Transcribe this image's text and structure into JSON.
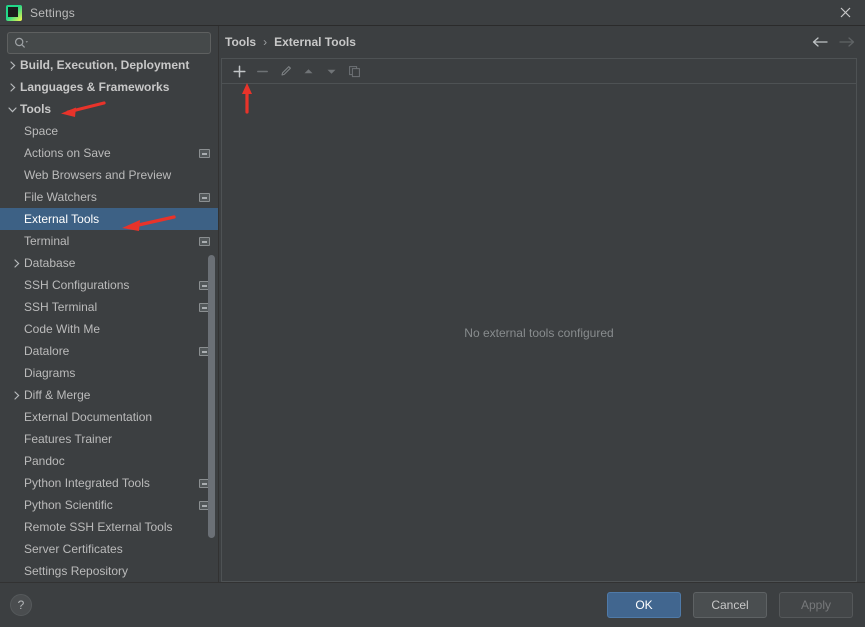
{
  "window": {
    "title": "Settings",
    "app_icon": "pycharm-logo-icon",
    "close_label": "×"
  },
  "search": {
    "value": "",
    "placeholder": "",
    "icon": "search-icon"
  },
  "sidebar": {
    "items": [
      {
        "label": "Build, Execution, Deployment",
        "level": 0,
        "group": true,
        "chevron": "›",
        "badge": false,
        "selected": false,
        "clipped": true
      },
      {
        "label": "Languages & Frameworks",
        "level": 0,
        "group": true,
        "chevron": "›",
        "badge": false,
        "selected": false
      },
      {
        "label": "Tools",
        "level": 0,
        "group": true,
        "chevron": "∨",
        "badge": false,
        "selected": false
      },
      {
        "label": "Space",
        "level": 1,
        "group": false,
        "chevron": "",
        "badge": false,
        "selected": false
      },
      {
        "label": "Actions on Save",
        "level": 1,
        "group": false,
        "chevron": "",
        "badge": true,
        "selected": false
      },
      {
        "label": "Web Browsers and Preview",
        "level": 1,
        "group": false,
        "chevron": "",
        "badge": false,
        "selected": false
      },
      {
        "label": "File Watchers",
        "level": 1,
        "group": false,
        "chevron": "",
        "badge": true,
        "selected": false
      },
      {
        "label": "External Tools",
        "level": 1,
        "group": false,
        "chevron": "",
        "badge": false,
        "selected": true
      },
      {
        "label": "Terminal",
        "level": 1,
        "group": false,
        "chevron": "",
        "badge": true,
        "selected": false
      },
      {
        "label": "Database",
        "level": 1,
        "group": false,
        "chevron": "›",
        "badge": false,
        "selected": false
      },
      {
        "label": "SSH Configurations",
        "level": 1,
        "group": false,
        "chevron": "",
        "badge": true,
        "selected": false
      },
      {
        "label": "SSH Terminal",
        "level": 1,
        "group": false,
        "chevron": "",
        "badge": true,
        "selected": false
      },
      {
        "label": "Code With Me",
        "level": 1,
        "group": false,
        "chevron": "",
        "badge": false,
        "selected": false
      },
      {
        "label": "Datalore",
        "level": 1,
        "group": false,
        "chevron": "",
        "badge": true,
        "selected": false
      },
      {
        "label": "Diagrams",
        "level": 1,
        "group": false,
        "chevron": "",
        "badge": false,
        "selected": false
      },
      {
        "label": "Diff & Merge",
        "level": 1,
        "group": false,
        "chevron": "›",
        "badge": false,
        "selected": false
      },
      {
        "label": "External Documentation",
        "level": 1,
        "group": false,
        "chevron": "",
        "badge": false,
        "selected": false
      },
      {
        "label": "Features Trainer",
        "level": 1,
        "group": false,
        "chevron": "",
        "badge": false,
        "selected": false
      },
      {
        "label": "Pandoc",
        "level": 1,
        "group": false,
        "chevron": "",
        "badge": false,
        "selected": false
      },
      {
        "label": "Python Integrated Tools",
        "level": 1,
        "group": false,
        "chevron": "",
        "badge": true,
        "selected": false
      },
      {
        "label": "Python Scientific",
        "level": 1,
        "group": false,
        "chevron": "",
        "badge": true,
        "selected": false
      },
      {
        "label": "Remote SSH External Tools",
        "level": 1,
        "group": false,
        "chevron": "",
        "badge": false,
        "selected": false
      },
      {
        "label": "Server Certificates",
        "level": 1,
        "group": false,
        "chevron": "",
        "badge": false,
        "selected": false
      },
      {
        "label": "Settings Repository",
        "level": 1,
        "group": false,
        "chevron": "",
        "badge": false,
        "selected": false
      }
    ]
  },
  "breadcrumb": {
    "root": "Tools",
    "separator": "›",
    "current": "External Tools",
    "back_icon": "arrow-left-icon",
    "forward_icon": "arrow-right-icon"
  },
  "toolbar": {
    "buttons": [
      {
        "name": "add-button",
        "glyph": "+",
        "enabled": true
      },
      {
        "name": "remove-button",
        "glyph": "−",
        "enabled": false
      },
      {
        "name": "edit-button",
        "glyph": "pencil",
        "enabled": false
      },
      {
        "name": "move-up-button",
        "glyph": "triangle-up",
        "enabled": false
      },
      {
        "name": "move-down-button",
        "glyph": "triangle-down",
        "enabled": false
      },
      {
        "name": "copy-button",
        "glyph": "copy",
        "enabled": false
      }
    ]
  },
  "main": {
    "empty_message": "No external tools configured"
  },
  "footer": {
    "help_label": "?",
    "ok_label": "OK",
    "cancel_label": "Cancel",
    "apply_label": "Apply"
  },
  "annotations": {
    "color": "#e8332a",
    "tools_arrow": "red-arrow-pointing-at-tools",
    "external_tools_arrow": "red-arrow-pointing-at-external-tools",
    "add-button_arrow": "red-arrow-pointing-at-add-button"
  },
  "colors": {
    "background": "#3c3f41",
    "selection": "#3d6185",
    "primary_button": "#41668f",
    "text": "#bbbbbb",
    "annotation": "#e8332a"
  }
}
